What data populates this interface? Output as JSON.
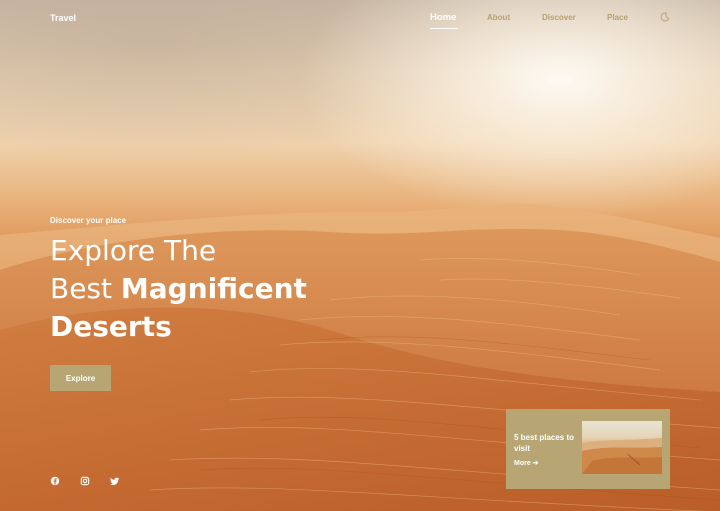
{
  "header": {
    "logo": "Travel",
    "nav": [
      "Home",
      "About",
      "Discover",
      "Place"
    ],
    "active_nav": "Home",
    "theme_toggle_icon": "moon-icon"
  },
  "hero": {
    "subtitle": "Discover your place",
    "title_line1": "Explore The",
    "title_line2_light": "Best",
    "title_line2_bold": "Magnificent",
    "title_line3_bold": "Deserts",
    "button_label": "Explore"
  },
  "social": {
    "icons": [
      "facebook-icon",
      "instagram-icon",
      "twitter-icon"
    ]
  },
  "card": {
    "title": "5 best places to visit",
    "more_label": "More ➔"
  },
  "colors": {
    "accent": "#b7a674",
    "nav_inactive": "#b6a06f",
    "text": "#ffffff"
  }
}
